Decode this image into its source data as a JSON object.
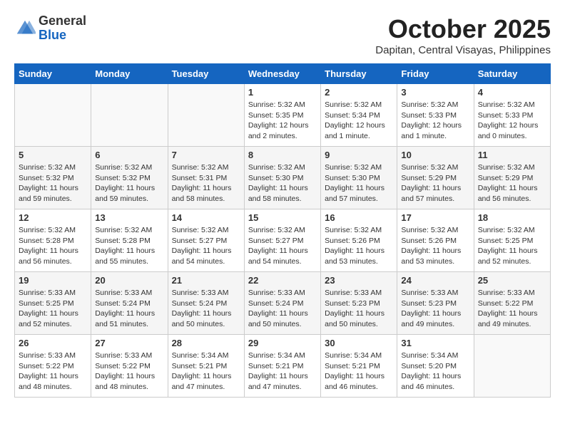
{
  "header": {
    "logo_line1": "General",
    "logo_line2": "Blue",
    "month": "October 2025",
    "location": "Dapitan, Central Visayas, Philippines"
  },
  "weekdays": [
    "Sunday",
    "Monday",
    "Tuesday",
    "Wednesday",
    "Thursday",
    "Friday",
    "Saturday"
  ],
  "weeks": [
    [
      {
        "day": "",
        "sunrise": "",
        "sunset": "",
        "daylight": ""
      },
      {
        "day": "",
        "sunrise": "",
        "sunset": "",
        "daylight": ""
      },
      {
        "day": "",
        "sunrise": "",
        "sunset": "",
        "daylight": ""
      },
      {
        "day": "1",
        "sunrise": "5:32 AM",
        "sunset": "5:35 PM",
        "daylight": "12 hours and 2 minutes."
      },
      {
        "day": "2",
        "sunrise": "5:32 AM",
        "sunset": "5:34 PM",
        "daylight": "12 hours and 1 minute."
      },
      {
        "day": "3",
        "sunrise": "5:32 AM",
        "sunset": "5:33 PM",
        "daylight": "12 hours and 1 minute."
      },
      {
        "day": "4",
        "sunrise": "5:32 AM",
        "sunset": "5:33 PM",
        "daylight": "12 hours and 0 minutes."
      }
    ],
    [
      {
        "day": "5",
        "sunrise": "5:32 AM",
        "sunset": "5:32 PM",
        "daylight": "11 hours and 59 minutes."
      },
      {
        "day": "6",
        "sunrise": "5:32 AM",
        "sunset": "5:32 PM",
        "daylight": "11 hours and 59 minutes."
      },
      {
        "day": "7",
        "sunrise": "5:32 AM",
        "sunset": "5:31 PM",
        "daylight": "11 hours and 58 minutes."
      },
      {
        "day": "8",
        "sunrise": "5:32 AM",
        "sunset": "5:30 PM",
        "daylight": "11 hours and 58 minutes."
      },
      {
        "day": "9",
        "sunrise": "5:32 AM",
        "sunset": "5:30 PM",
        "daylight": "11 hours and 57 minutes."
      },
      {
        "day": "10",
        "sunrise": "5:32 AM",
        "sunset": "5:29 PM",
        "daylight": "11 hours and 57 minutes."
      },
      {
        "day": "11",
        "sunrise": "5:32 AM",
        "sunset": "5:29 PM",
        "daylight": "11 hours and 56 minutes."
      }
    ],
    [
      {
        "day": "12",
        "sunrise": "5:32 AM",
        "sunset": "5:28 PM",
        "daylight": "11 hours and 56 minutes."
      },
      {
        "day": "13",
        "sunrise": "5:32 AM",
        "sunset": "5:28 PM",
        "daylight": "11 hours and 55 minutes."
      },
      {
        "day": "14",
        "sunrise": "5:32 AM",
        "sunset": "5:27 PM",
        "daylight": "11 hours and 54 minutes."
      },
      {
        "day": "15",
        "sunrise": "5:32 AM",
        "sunset": "5:27 PM",
        "daylight": "11 hours and 54 minutes."
      },
      {
        "day": "16",
        "sunrise": "5:32 AM",
        "sunset": "5:26 PM",
        "daylight": "11 hours and 53 minutes."
      },
      {
        "day": "17",
        "sunrise": "5:32 AM",
        "sunset": "5:26 PM",
        "daylight": "11 hours and 53 minutes."
      },
      {
        "day": "18",
        "sunrise": "5:32 AM",
        "sunset": "5:25 PM",
        "daylight": "11 hours and 52 minutes."
      }
    ],
    [
      {
        "day": "19",
        "sunrise": "5:33 AM",
        "sunset": "5:25 PM",
        "daylight": "11 hours and 52 minutes."
      },
      {
        "day": "20",
        "sunrise": "5:33 AM",
        "sunset": "5:24 PM",
        "daylight": "11 hours and 51 minutes."
      },
      {
        "day": "21",
        "sunrise": "5:33 AM",
        "sunset": "5:24 PM",
        "daylight": "11 hours and 50 minutes."
      },
      {
        "day": "22",
        "sunrise": "5:33 AM",
        "sunset": "5:24 PM",
        "daylight": "11 hours and 50 minutes."
      },
      {
        "day": "23",
        "sunrise": "5:33 AM",
        "sunset": "5:23 PM",
        "daylight": "11 hours and 50 minutes."
      },
      {
        "day": "24",
        "sunrise": "5:33 AM",
        "sunset": "5:23 PM",
        "daylight": "11 hours and 49 minutes."
      },
      {
        "day": "25",
        "sunrise": "5:33 AM",
        "sunset": "5:22 PM",
        "daylight": "11 hours and 49 minutes."
      }
    ],
    [
      {
        "day": "26",
        "sunrise": "5:33 AM",
        "sunset": "5:22 PM",
        "daylight": "11 hours and 48 minutes."
      },
      {
        "day": "27",
        "sunrise": "5:33 AM",
        "sunset": "5:22 PM",
        "daylight": "11 hours and 48 minutes."
      },
      {
        "day": "28",
        "sunrise": "5:34 AM",
        "sunset": "5:21 PM",
        "daylight": "11 hours and 47 minutes."
      },
      {
        "day": "29",
        "sunrise": "5:34 AM",
        "sunset": "5:21 PM",
        "daylight": "11 hours and 47 minutes."
      },
      {
        "day": "30",
        "sunrise": "5:34 AM",
        "sunset": "5:21 PM",
        "daylight": "11 hours and 46 minutes."
      },
      {
        "day": "31",
        "sunrise": "5:34 AM",
        "sunset": "5:20 PM",
        "daylight": "11 hours and 46 minutes."
      },
      {
        "day": "",
        "sunrise": "",
        "sunset": "",
        "daylight": ""
      }
    ]
  ]
}
